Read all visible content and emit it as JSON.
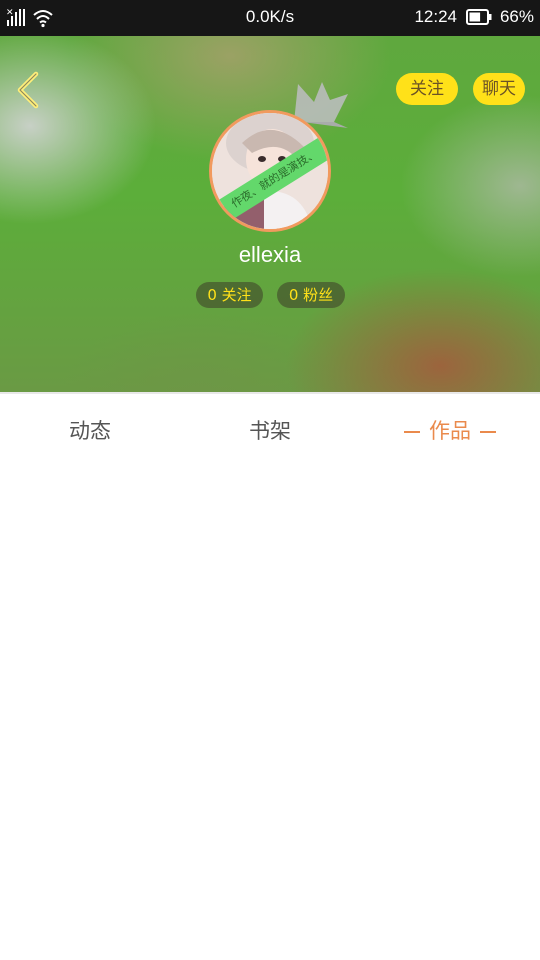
{
  "status_bar": {
    "net_speed": "0.0K/s",
    "time": "12:24",
    "battery_percent": "66%",
    "battery_level": 0.66,
    "icons": [
      "signal-icon",
      "wifi-icon",
      "battery-icon"
    ]
  },
  "header": {
    "back_icon": "back-chevron-icon",
    "follow_label": "关注",
    "chat_label": "聊天",
    "username": "ellexia",
    "following_stat": "0 关注",
    "fans_stat": "0 粉丝",
    "avatar_banner_text": "作夜、就的是演技、",
    "colors": {
      "accent_yellow": "#ffe119",
      "avatar_border": "#f19a5e"
    }
  },
  "tabs": [
    {
      "label": "动态",
      "active": false
    },
    {
      "label": "书架",
      "active": false
    },
    {
      "label": "作品",
      "active": true
    }
  ],
  "colors": {
    "active_tab": "#ea8a4c",
    "inactive_tab": "#555555"
  }
}
